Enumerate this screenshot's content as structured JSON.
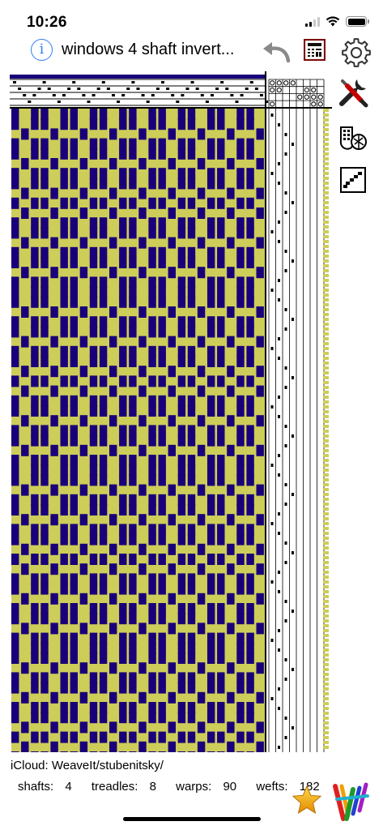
{
  "status": {
    "time": "10:26",
    "signal_level": 2,
    "icons": [
      "cellular-signal-icon",
      "wifi-icon",
      "battery-icon"
    ]
  },
  "header": {
    "title": "windows 4 shaft invert...",
    "icons": [
      "info-icon",
      "undo-icon",
      "calculator-icon",
      "gear-icon"
    ]
  },
  "side_tools": [
    "tools-icon",
    "lift-plan-icon",
    "twill-icon"
  ],
  "draft": {
    "colors": {
      "warp": "#19007a",
      "weft": "#cdcd5a",
      "grid": "#000000",
      "mark": "#000000"
    }
  },
  "footer": {
    "path": "iCloud: WeaveIt/stubenitsky/",
    "shafts_label": "shafts:",
    "shafts": "4",
    "treadles_label": "treadles:",
    "treadles": "8",
    "warps_label": "warps:",
    "warps": "90",
    "wefts_label": "wefts:",
    "wefts": "182",
    "icons": [
      "favorite-star-icon",
      "weaveit-logo-icon"
    ]
  }
}
